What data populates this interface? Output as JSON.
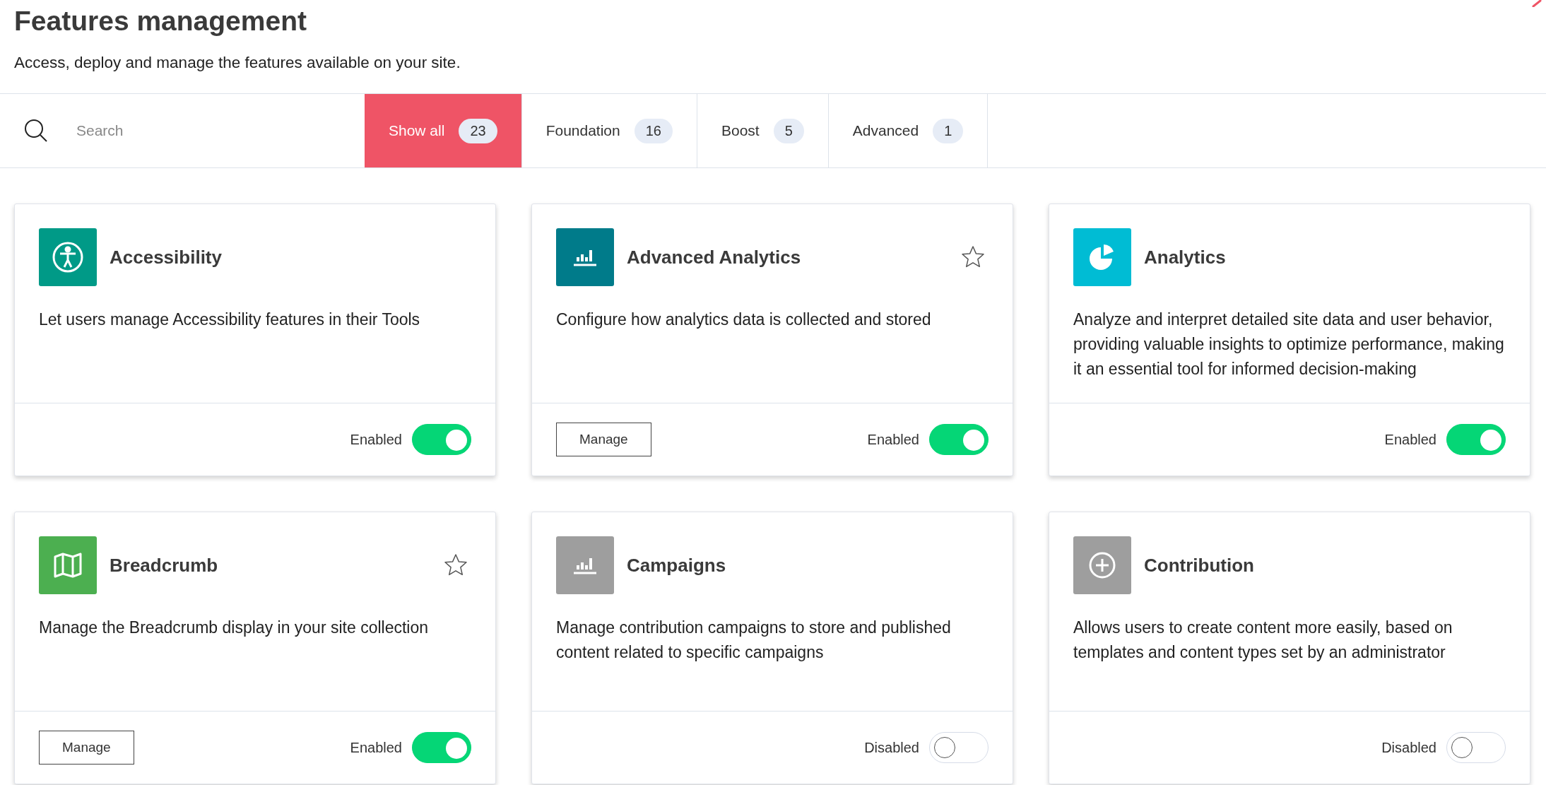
{
  "header": {
    "title": "Features management",
    "subtitle": "Access, deploy and manage the features available on your site."
  },
  "search": {
    "placeholder": "Search"
  },
  "filters": [
    {
      "label": "Show all",
      "count": "23",
      "selected": true
    },
    {
      "label": "Foundation",
      "count": "16",
      "selected": false
    },
    {
      "label": "Boost",
      "count": "5",
      "selected": false
    },
    {
      "label": "Advanced",
      "count": "1",
      "selected": false
    }
  ],
  "features": [
    {
      "kind": "accessibility",
      "color": "#009a87",
      "title": "Accessibility",
      "description": "Let users manage Accessibility features in their Tools",
      "enabled": true,
      "status": "Enabled"
    },
    {
      "kind": "bars",
      "color": "#007b8a",
      "title": "Advanced Analytics",
      "starred": false,
      "description": "Configure how analytics data is collected and stored",
      "action": "Manage",
      "enabled": true,
      "status": "Enabled"
    },
    {
      "kind": "pie",
      "color": "#00bcd4",
      "title": "Analytics",
      "description": "Analyze and interpret detailed site data and user behavior, providing valuable insights to optimize performance, making it an essential tool for informed decision-making",
      "enabled": true,
      "status": "Enabled"
    },
    {
      "kind": "map",
      "color": "#4caf50",
      "title": "Breadcrumb",
      "starred": false,
      "description": "Manage the Breadcrumb display in your site collection",
      "action": "Manage",
      "enabled": true,
      "status": "Enabled"
    },
    {
      "kind": "bars",
      "color": "#9e9e9e",
      "title": "Campaigns",
      "description": "Manage contribution campaigns to store and published content related to specific campaigns",
      "enabled": false,
      "status": "Disabled"
    },
    {
      "kind": "plus",
      "color": "#9e9e9e",
      "title": "Contribution",
      "description": "Allows users to create content more easily, based on templates and content types set by an administrator",
      "enabled": false,
      "status": "Disabled"
    }
  ]
}
